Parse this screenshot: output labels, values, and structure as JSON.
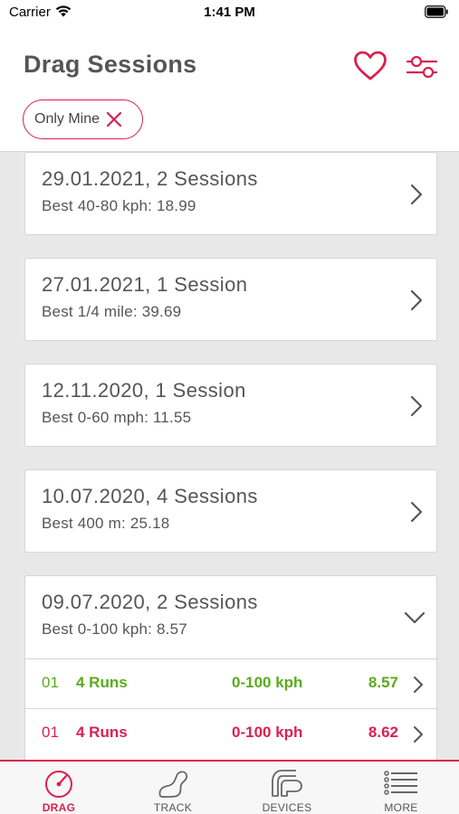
{
  "status_bar": {
    "carrier": "Carrier",
    "time": "1:41 PM"
  },
  "header": {
    "title": "Drag Sessions"
  },
  "filter_chip": {
    "label": "Only Mine"
  },
  "sessions": [
    {
      "title": "29.01.2021, 2 Sessions",
      "best": "Best 40-80 kph: 18.99"
    },
    {
      "title": "27.01.2021, 1 Session",
      "best": "Best 1/4 mile: 39.69"
    },
    {
      "title": "12.11.2020, 1 Session",
      "best": "Best 0-60 mph: 11.55"
    },
    {
      "title": "10.07.2020, 4 Sessions",
      "best": "Best 400 m: 25.18"
    },
    {
      "title": "09.07.2020, 2 Sessions",
      "best": "Best 0-100 kph: 8.57"
    }
  ],
  "runs": [
    {
      "num": "01",
      "count": "4 Runs",
      "type": "0-100 kph",
      "time": "8.57",
      "status": "green"
    },
    {
      "num": "01",
      "count": "4 Runs",
      "type": "0-100 kph",
      "time": "8.62",
      "status": "red"
    }
  ],
  "tabs": [
    {
      "label": "DRAG",
      "icon": "gauge-icon",
      "active": true
    },
    {
      "label": "TRACK",
      "icon": "track-icon",
      "active": false
    },
    {
      "label": "DEVICES",
      "icon": "devices-icon",
      "active": false
    },
    {
      "label": "MORE",
      "icon": "menu-icon",
      "active": false
    }
  ],
  "colors": {
    "accent": "#d92050",
    "success": "#5aaa1e",
    "text": "#555555",
    "background": "#e8e8e8"
  }
}
